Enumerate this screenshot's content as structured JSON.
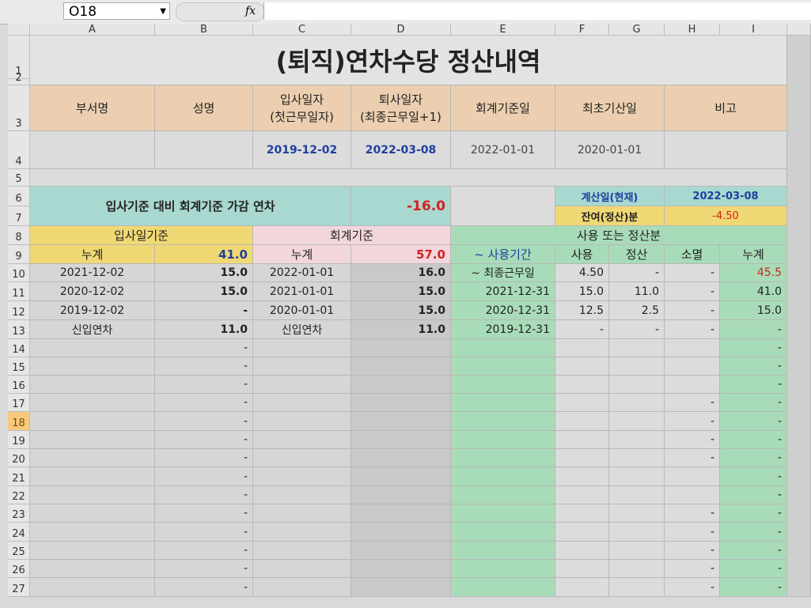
{
  "namebox": "O18",
  "fx": "fx",
  "columns": [
    "A",
    "B",
    "C",
    "D",
    "E",
    "F",
    "G",
    "H",
    "I"
  ],
  "rows": [
    "1",
    "2",
    "3",
    "4",
    "5",
    "6",
    "7",
    "8",
    "9",
    "10",
    "11",
    "12",
    "13",
    "14",
    "15",
    "16",
    "17",
    "18",
    "19",
    "20",
    "21",
    "22",
    "23",
    "24",
    "25",
    "26",
    "27"
  ],
  "title": "(퇴직)연차수당 정산내역",
  "header": {
    "dept": "부서명",
    "name": "성명",
    "hire_l1": "입사일자",
    "hire_l2": "(첫근무일자)",
    "retire_l1": "퇴사일자",
    "retire_l2": "(최종근무일+1)",
    "acct_base": "회계기준일",
    "first_calc": "최초기산일",
    "note": "비고"
  },
  "info": {
    "hire_date": "2019-12-02",
    "retire_date": "2022-03-08",
    "acct_base_date": "2022-01-01",
    "first_calc_date": "2020-01-01"
  },
  "summary": {
    "label": "입사기준 대비 회계기준 가감 연차",
    "value": "-16.0",
    "calc_label": "계산일(현재)",
    "calc_value": "2022-03-08",
    "balance_label": "잔여(정산)분",
    "balance_value": "-4.50"
  },
  "sections": {
    "hire_basis": "입사일기준",
    "acct_basis": "회계기준",
    "usage": "사용 또는 정산분"
  },
  "subheader": {
    "cum": "누계",
    "hire_total": "41.0",
    "acct_total": "57.0",
    "period": "~ 사용기간",
    "use": "사용",
    "settle": "정산",
    "expire": "소멸",
    "cum2": "누계"
  },
  "table": [
    {
      "a": "2021-12-02",
      "b": "15.0",
      "c": "2022-01-01",
      "d": "16.0",
      "e": "~ 최종근무일",
      "f": "4.50",
      "g": "-",
      "h": "-",
      "i": "45.5"
    },
    {
      "a": "2020-12-02",
      "b": "15.0",
      "c": "2021-01-01",
      "d": "15.0",
      "e": "2021-12-31",
      "f": "15.0",
      "g": "11.0",
      "h": "-",
      "i": "41.0"
    },
    {
      "a": "2019-12-02",
      "b": "-",
      "c": "2020-01-01",
      "d": "15.0",
      "e": "2020-12-31",
      "f": "12.5",
      "g": "2.5",
      "h": "-",
      "i": "15.0"
    },
    {
      "a": "신입연차",
      "b": "11.0",
      "c": "신입연차",
      "d": "11.0",
      "e": "2019-12-31",
      "f": "-",
      "g": "-",
      "h": "-",
      "i": "-"
    }
  ],
  "dash": "-",
  "colors": {
    "blue_text": "#1f3f9f",
    "red_text": "#d62020",
    "teal": "#a8d8d0",
    "yellow": "#f0d874",
    "pink": "#f3d6dc",
    "green": "#a8dcb8",
    "tan": "#ebcfb0"
  }
}
